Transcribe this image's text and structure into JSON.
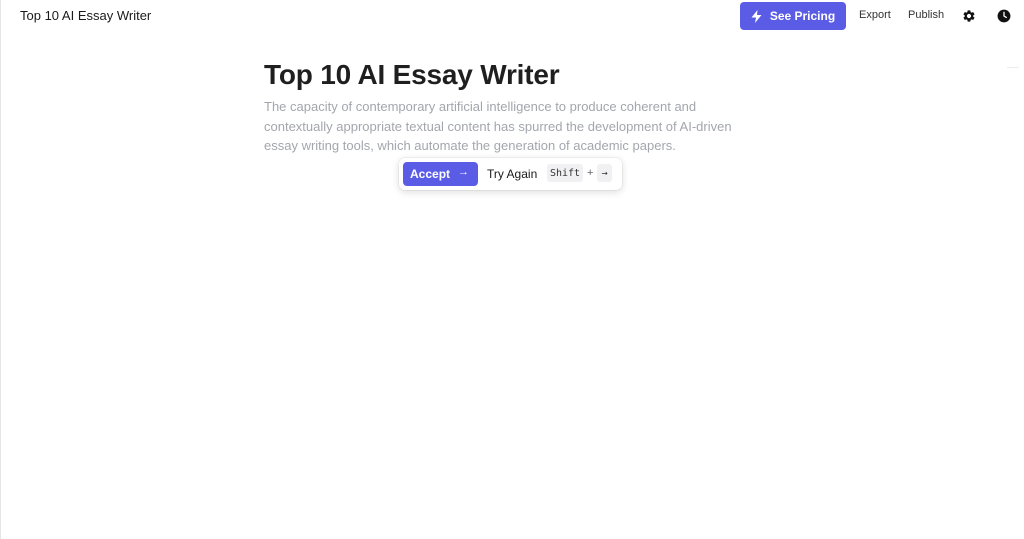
{
  "header": {
    "doc_title": "Top 10 AI Essay Writer",
    "pricing_label": "See Pricing",
    "export_label": "Export",
    "publish_label": "Publish",
    "accent_color": "#5b5ce6"
  },
  "editor": {
    "headline": "Top 10 AI Essay Writer",
    "suggestion_text": "The capacity of contemporary artificial intelligence to produce coherent and contextually appropriate textual content has spurred the development of AI-driven essay writing tools, which automate the generation of academic papers."
  },
  "suggestion_popover": {
    "accept_label": "Accept",
    "accept_arrow": "→",
    "try_again_label": "Try Again",
    "shortcut_key": "Shift",
    "shortcut_plus": "+",
    "shortcut_arrow": "→"
  },
  "icons": {
    "pricing": "lightning-icon",
    "settings": "gear-icon",
    "history": "clock-icon"
  }
}
